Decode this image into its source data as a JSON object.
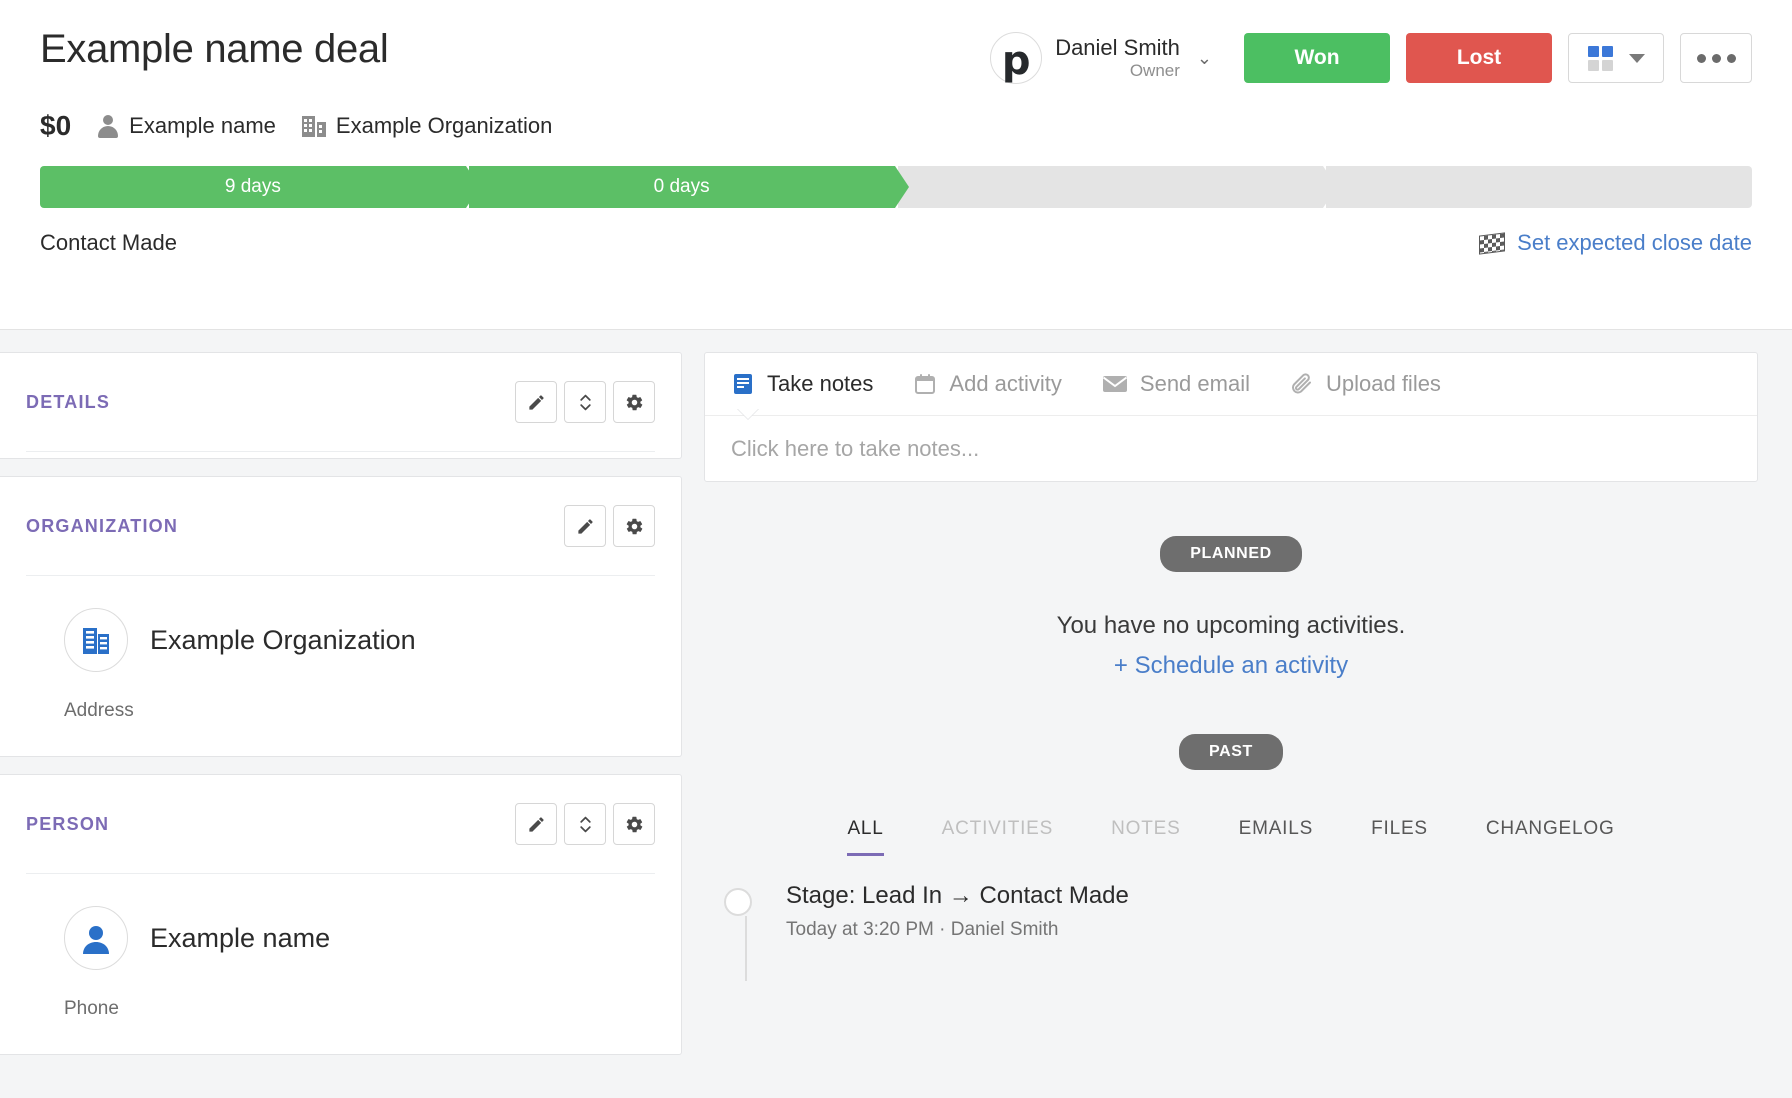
{
  "header": {
    "deal_title": "Example name deal",
    "deal_value": "$0",
    "person_name": "Example name",
    "organization_name": "Example Organization",
    "owner": {
      "name": "Daniel Smith",
      "role": "Owner",
      "avatar_letter": "p"
    },
    "won_label": "Won",
    "lost_label": "Lost"
  },
  "pipeline": {
    "stages": [
      {
        "label": "9 days",
        "state": "done"
      },
      {
        "label": "0 days",
        "state": "done"
      },
      {
        "label": "",
        "state": "todo"
      },
      {
        "label": "",
        "state": "todo"
      }
    ],
    "current_stage_label": "Contact Made",
    "close_date_link": "Set expected close date"
  },
  "sidebar": {
    "cards": [
      {
        "title": "DETAILS",
        "buttons": [
          "pencil",
          "collapse",
          "gear"
        ]
      },
      {
        "title": "ORGANIZATION",
        "buttons": [
          "pencil",
          "gear"
        ],
        "entity_name": "Example Organization",
        "field_label": "Address"
      },
      {
        "title": "PERSON",
        "buttons": [
          "pencil",
          "collapse",
          "gear"
        ],
        "entity_name": "Example name",
        "field_label": "Phone"
      }
    ]
  },
  "main": {
    "note_tabs": [
      {
        "label": "Take notes",
        "icon": "note-icon",
        "active": true
      },
      {
        "label": "Add activity",
        "icon": "calendar-icon",
        "active": false
      },
      {
        "label": "Send email",
        "icon": "envelope-icon",
        "active": false
      },
      {
        "label": "Upload files",
        "icon": "paperclip-icon",
        "active": false
      }
    ],
    "note_placeholder": "Click here to take notes...",
    "planned_label": "PLANNED",
    "empty_activities_message": "You have no upcoming activities.",
    "schedule_link": "+ Schedule an activity",
    "past_label": "PAST",
    "filter_tabs": [
      {
        "label": "ALL",
        "state": "active"
      },
      {
        "label": "ACTIVITIES",
        "state": "muted"
      },
      {
        "label": "NOTES",
        "state": "muted"
      },
      {
        "label": "EMAILS",
        "state": "normal"
      },
      {
        "label": "FILES",
        "state": "normal"
      },
      {
        "label": "CHANGELOG",
        "state": "normal"
      }
    ],
    "timeline": [
      {
        "title": "Stage: Lead In → Contact Made",
        "meta": "Today at 3:20 PM  ·  Daniel Smith"
      }
    ]
  },
  "colors": {
    "won_green": "#4cbf62",
    "lost_red": "#e0564f",
    "stage_green": "#5cbf66",
    "accent_purple": "#7c6bb5",
    "link_blue": "#4a7ec9"
  }
}
